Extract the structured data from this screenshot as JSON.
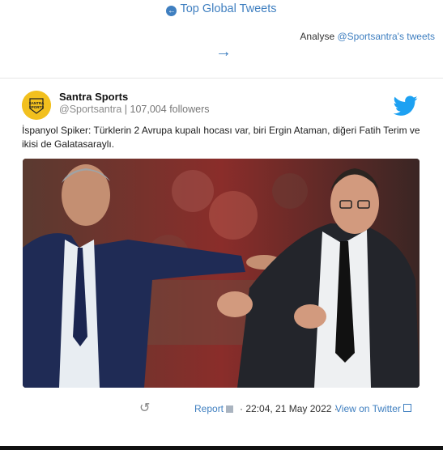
{
  "header": {
    "top_link_label": "Top Global Tweets",
    "analyse_prefix": "Analyse",
    "analyse_link": "@Sportsantra's tweets",
    "next_icon": "arrow-right-icon"
  },
  "tweet": {
    "user_name": "Santra Sports",
    "handle": "@Sportsantra",
    "separator": "|",
    "followers": "107,004 followers",
    "avatar_text": "SANTRA SPORTS",
    "text": "İspanyol Spiker: Türklerin 2 Avrupa kupalı hocası var, biri Ergin Ataman, diğeri Fatih Terim ve ikisi de Galatasaraylı.",
    "brand_color": "#1da1f2",
    "avatar_color": "#f2c01e"
  },
  "footer": {
    "retweet_icon": "retweet-icon",
    "report_label": "Report",
    "dot": "·",
    "timestamp": "22:04, 21 May 2022",
    "view_label": "View on Twitter"
  }
}
